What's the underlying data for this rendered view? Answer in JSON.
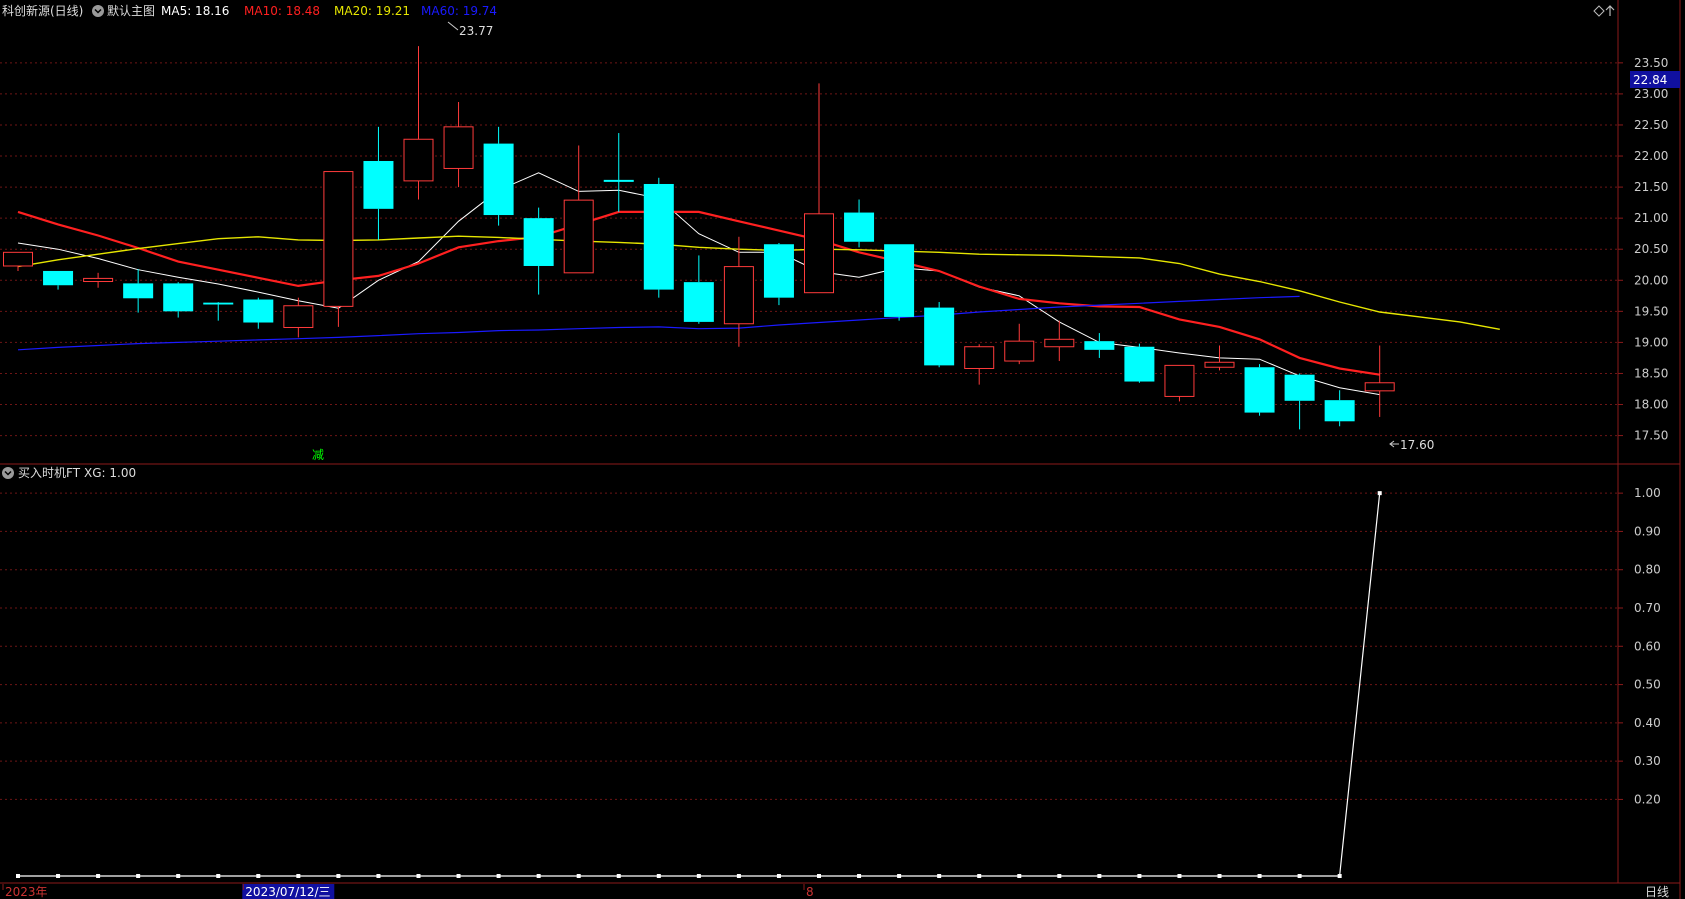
{
  "colors": {
    "background": "#000000",
    "frame": "#8b1a1a",
    "grid": "#6e1515",
    "up_candle": "#ff3b3b",
    "down_candle": "#00ffff",
    "ma5": "#ffffff",
    "ma10": "#ff2020",
    "ma20": "#e6e600",
    "ma60": "#1a1aff",
    "price_tag_bg": "#1010a0",
    "signal_text": "#00ff00"
  },
  "main_panel": {
    "title": "科创新源(日线)",
    "menu_icon": "chevron-down-circle-icon",
    "indicator_name": "默认主图",
    "ma_labels": [
      {
        "label": "MA5: 18.16",
        "color_key": "ma5"
      },
      {
        "label": "MA10: 18.48",
        "color_key": "ma10"
      },
      {
        "label": "MA20: 19.21",
        "color_key": "ma20"
      },
      {
        "label": "MA60: 19.74",
        "color_key": "ma60"
      }
    ],
    "corner_icons": [
      "diamond-icon",
      "up-arrow-icon"
    ],
    "current_price_tag": "22.84",
    "high_annotation": "23.77",
    "low_annotation": "17.60",
    "signal_marker": "减"
  },
  "sub_panel": {
    "title": "买入时机FT",
    "value_label": "XG: 1.00"
  },
  "x_axis_labels": [
    {
      "text": "2023年",
      "highlight": false,
      "index": 0
    },
    {
      "text": "2023/07/12/三",
      "highlight": true,
      "index": 6
    },
    {
      "text": "8",
      "highlight": false,
      "index": 20
    }
  ],
  "period_label": "日线",
  "chart_data": [
    {
      "type": "candlestick",
      "title": "科创新源(日线)",
      "ylim": [
        17.3,
        23.9
      ],
      "y_ticks": [
        "23.50",
        "23.00",
        "22.50",
        "22.00",
        "21.50",
        "21.00",
        "20.50",
        "20.00",
        "19.50",
        "19.00",
        "18.50",
        "18.00",
        "17.50"
      ],
      "grid": true,
      "candles": [
        {
          "o": 20.23,
          "c": 20.45,
          "h": 20.45,
          "l": 20.15
        },
        {
          "o": 20.15,
          "c": 19.92,
          "h": 20.15,
          "l": 19.85
        },
        {
          "o": 19.98,
          "c": 20.03,
          "h": 20.12,
          "l": 19.88
        },
        {
          "o": 19.95,
          "c": 19.71,
          "h": 20.18,
          "l": 19.48
        },
        {
          "o": 19.95,
          "c": 19.5,
          "h": 19.97,
          "l": 19.4
        },
        {
          "o": 19.64,
          "c": 19.61,
          "h": 19.65,
          "l": 19.35
        },
        {
          "o": 19.69,
          "c": 19.32,
          "h": 19.72,
          "l": 19.22
        },
        {
          "o": 19.24,
          "c": 19.59,
          "h": 19.72,
          "l": 19.08
        },
        {
          "o": 19.58,
          "c": 21.75,
          "h": 21.75,
          "l": 19.25
        },
        {
          "o": 21.92,
          "c": 21.15,
          "h": 22.47,
          "l": 20.65
        },
        {
          "o": 21.6,
          "c": 22.27,
          "h": 23.77,
          "l": 21.3
        },
        {
          "o": 21.8,
          "c": 22.47,
          "h": 22.87,
          "l": 21.5
        },
        {
          "o": 22.2,
          "c": 21.05,
          "h": 22.47,
          "l": 20.88
        },
        {
          "o": 21.0,
          "c": 20.23,
          "h": 21.17,
          "l": 19.77
        },
        {
          "o": 20.12,
          "c": 21.29,
          "h": 22.17,
          "l": 20.12
        },
        {
          "o": 21.6,
          "c": 21.6,
          "h": 22.37,
          "l": 21.1
        },
        {
          "o": 21.55,
          "c": 19.85,
          "h": 21.65,
          "l": 19.72
        },
        {
          "o": 19.97,
          "c": 19.33,
          "h": 20.4,
          "l": 19.3
        },
        {
          "o": 19.3,
          "c": 20.22,
          "h": 20.7,
          "l": 18.93
        },
        {
          "o": 20.58,
          "c": 19.72,
          "h": 20.6,
          "l": 19.6
        },
        {
          "o": 19.8,
          "c": 21.07,
          "h": 23.17,
          "l": 19.8
        },
        {
          "o": 21.09,
          "c": 20.62,
          "h": 21.3,
          "l": 20.53
        },
        {
          "o": 20.58,
          "c": 19.41,
          "h": 20.58,
          "l": 19.35
        },
        {
          "o": 19.56,
          "c": 18.63,
          "h": 19.65,
          "l": 18.6
        },
        {
          "o": 18.58,
          "c": 18.93,
          "h": 18.97,
          "l": 18.32
        },
        {
          "o": 18.7,
          "c": 19.02,
          "h": 19.3,
          "l": 18.65
        },
        {
          "o": 18.93,
          "c": 19.05,
          "h": 19.35,
          "l": 18.7
        },
        {
          "o": 19.02,
          "c": 18.88,
          "h": 19.15,
          "l": 18.75
        },
        {
          "o": 18.93,
          "c": 18.37,
          "h": 18.98,
          "l": 18.35
        },
        {
          "o": 18.13,
          "c": 18.63,
          "h": 18.63,
          "l": 18.05
        },
        {
          "o": 18.6,
          "c": 18.68,
          "h": 18.95,
          "l": 18.55
        },
        {
          "o": 18.6,
          "c": 17.87,
          "h": 18.65,
          "l": 17.82
        },
        {
          "o": 18.48,
          "c": 18.06,
          "h": 18.5,
          "l": 17.6
        },
        {
          "o": 18.07,
          "c": 17.73,
          "h": 18.23,
          "l": 17.65
        },
        {
          "o": 18.22,
          "c": 18.35,
          "h": 18.95,
          "l": 17.8
        }
      ],
      "series": [
        {
          "name": "MA5",
          "color_key": "ma5",
          "width": 1,
          "values": [
            20.6,
            20.5,
            20.35,
            20.17,
            20.05,
            19.94,
            19.81,
            19.67,
            19.55,
            20.0,
            20.3,
            20.95,
            21.45,
            21.73,
            21.43,
            21.45,
            21.32,
            20.75,
            20.45,
            20.45,
            20.14,
            20.05,
            20.2,
            20.15,
            19.89,
            19.75,
            19.33,
            19.0,
            18.92,
            18.83,
            18.75,
            18.73,
            18.46,
            18.27,
            18.16
          ]
        },
        {
          "name": "MA10",
          "color_key": "ma10",
          "width": 2.2,
          "values": [
            21.1,
            20.9,
            20.72,
            20.52,
            20.3,
            20.17,
            20.04,
            19.91,
            20.0,
            20.07,
            20.27,
            20.53,
            20.63,
            20.7,
            20.9,
            21.1,
            21.1,
            21.1,
            20.95,
            20.8,
            20.65,
            20.45,
            20.3,
            20.15,
            19.9,
            19.7,
            19.63,
            19.58,
            19.57,
            19.37,
            19.25,
            19.05,
            18.75,
            18.58,
            18.48
          ]
        },
        {
          "name": "MA20",
          "color_key": "ma20",
          "width": 1.4,
          "values": [
            20.22,
            20.33,
            20.42,
            20.51,
            20.59,
            20.67,
            20.7,
            20.65,
            20.64,
            20.65,
            20.68,
            20.71,
            20.69,
            20.66,
            20.63,
            20.61,
            20.58,
            20.53,
            20.5,
            20.48,
            20.5,
            20.49,
            20.47,
            20.45,
            20.42,
            20.41,
            20.4,
            20.38,
            20.36,
            20.27,
            20.1,
            19.98,
            19.83,
            19.65,
            19.49,
            19.41,
            19.33,
            19.21
          ]
        },
        {
          "name": "MA60",
          "color_key": "ma60",
          "width": 1.2,
          "values": [
            18.88,
            18.92,
            18.95,
            18.98,
            19.0,
            19.02,
            19.04,
            19.06,
            19.08,
            19.11,
            19.14,
            19.16,
            19.19,
            19.2,
            19.22,
            19.24,
            19.25,
            19.22,
            19.23,
            19.28,
            19.32,
            19.36,
            19.4,
            19.44,
            19.49,
            19.53,
            19.57,
            19.6,
            19.63,
            19.66,
            19.69,
            19.72,
            19.74
          ]
        }
      ]
    },
    {
      "type": "line",
      "title": "买入时机FT",
      "series": [
        {
          "name": "XG",
          "color_key": "ma5",
          "values": [
            0,
            0,
            0,
            0,
            0,
            0,
            0,
            0,
            0,
            0,
            0,
            0,
            0,
            0,
            0,
            0,
            0,
            0,
            0,
            0,
            0,
            0,
            0,
            0,
            0,
            0,
            0,
            0,
            0,
            0,
            0,
            0,
            0,
            0,
            1
          ]
        }
      ],
      "ylim": [
        0,
        1.05
      ],
      "y_ticks": [
        "1.00",
        "0.90",
        "0.80",
        "0.70",
        "0.60",
        "0.50",
        "0.40",
        "0.30",
        "0.20"
      ]
    }
  ]
}
